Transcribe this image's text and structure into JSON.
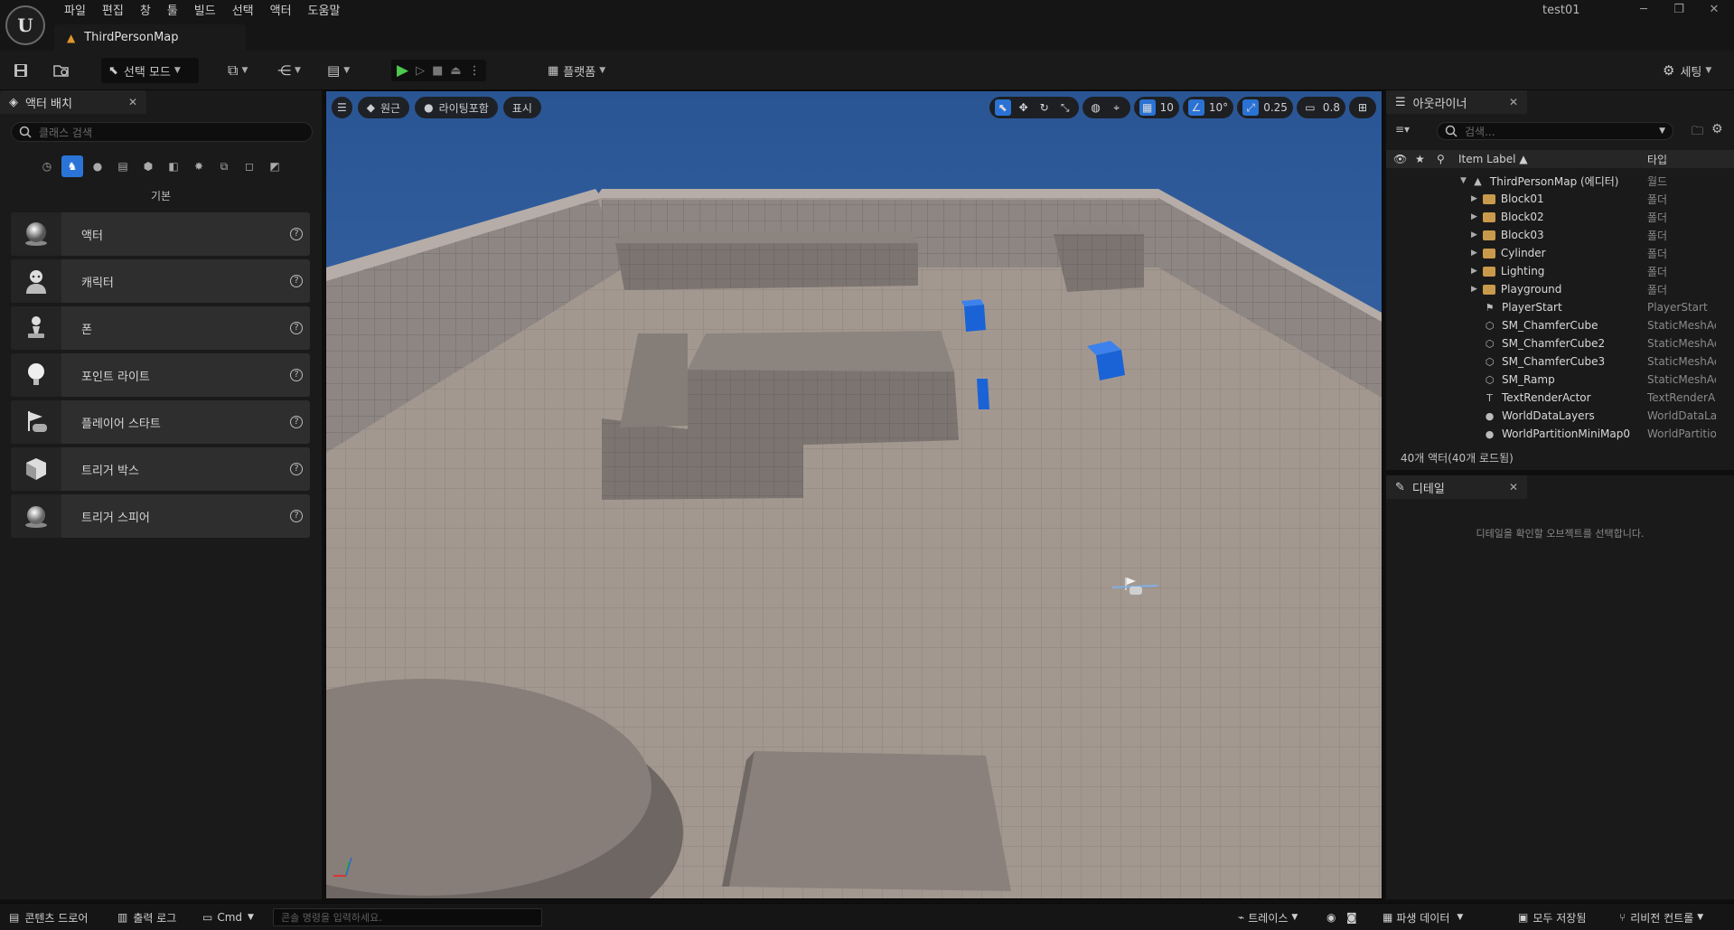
{
  "window": {
    "project_name": "test01",
    "menus": [
      "파일",
      "편집",
      "창",
      "툴",
      "빌드",
      "선택",
      "액터",
      "도움말"
    ],
    "document_tab": "ThirdPersonMap",
    "logo_letter": "U"
  },
  "toolbar": {
    "mode_select": "선택 모드",
    "platforms": "플랫폼",
    "settings": "세팅"
  },
  "place_actors": {
    "tab_title": "액터 배치",
    "search_placeholder": "클래스 검색",
    "category_label": "기본",
    "items": [
      {
        "label": "액터",
        "icon": "actor-sphere-icon"
      },
      {
        "label": "캐릭터",
        "icon": "character-icon"
      },
      {
        "label": "폰",
        "icon": "pawn-icon"
      },
      {
        "label": "포인트 라이트",
        "icon": "point-light-icon"
      },
      {
        "label": "플레이어 스타트",
        "icon": "player-start-icon"
      },
      {
        "label": "트리거 박스",
        "icon": "trigger-box-icon"
      },
      {
        "label": "트리거 스피어",
        "icon": "trigger-sphere-icon"
      }
    ]
  },
  "viewport": {
    "perspective": "원근",
    "lighting": "라이팅포함",
    "show": "표시",
    "grid_snap": "10",
    "rotation_snap": "10°",
    "scale_snap": "0.25",
    "camera_speed": "0.8",
    "colors": {
      "sky": "#2f5b9b",
      "floor": "#9e928a",
      "wall": "#8a8380",
      "cube": "#1a63d6",
      "active": "#2a74d8"
    }
  },
  "outliner": {
    "tab_title": "아웃라이너",
    "search_placeholder": "검색...",
    "col_label": "Item Label ▲",
    "col_type": "타입",
    "rows": [
      {
        "name": "ThirdPersonMap (에디터)",
        "type": "월드",
        "kind": "world",
        "indent": 0
      },
      {
        "name": "Block01",
        "type": "폴더",
        "kind": "folder",
        "indent": 1
      },
      {
        "name": "Block02",
        "type": "폴더",
        "kind": "folder",
        "indent": 1
      },
      {
        "name": "Block03",
        "type": "폴더",
        "kind": "folder",
        "indent": 1
      },
      {
        "name": "Cylinder",
        "type": "폴더",
        "kind": "folder",
        "indent": 1
      },
      {
        "name": "Lighting",
        "type": "폴더",
        "kind": "folder",
        "indent": 1
      },
      {
        "name": "Playground",
        "type": "폴더",
        "kind": "folder",
        "indent": 1
      },
      {
        "name": "PlayerStart",
        "type": "PlayerStart",
        "kind": "actor",
        "indent": 1
      },
      {
        "name": "SM_ChamferCube",
        "type": "StaticMeshAc",
        "kind": "mesh",
        "indent": 1
      },
      {
        "name": "SM_ChamferCube2",
        "type": "StaticMeshAc",
        "kind": "mesh",
        "indent": 1
      },
      {
        "name": "SM_ChamferCube3",
        "type": "StaticMeshAc",
        "kind": "mesh",
        "indent": 1
      },
      {
        "name": "SM_Ramp",
        "type": "StaticMeshAc",
        "kind": "mesh",
        "indent": 1
      },
      {
        "name": "TextRenderActor",
        "type": "TextRenderA",
        "kind": "text",
        "indent": 1
      },
      {
        "name": "WorldDataLayers",
        "type": "WorldDataLa",
        "kind": "sphere",
        "indent": 1
      },
      {
        "name": "WorldPartitionMiniMap0",
        "type": "WorldPartitio",
        "kind": "sphere",
        "indent": 1
      }
    ],
    "count_text": "40개 액터(40개 로드됨)"
  },
  "details": {
    "tab_title": "디테일",
    "empty_text": "디테일을 확인할 오브젝트를 선택합니다."
  },
  "bottom": {
    "content_drawer": "콘텐츠 드로어",
    "output_log": "출력 로그",
    "cmd": "Cmd",
    "console_placeholder": "콘솔 명령을 입력하세요.",
    "trace": "트레이스",
    "derived_data": "파생 데이터",
    "save_all": "모두 저장됨",
    "revision_control": "리비전 컨트롤"
  }
}
